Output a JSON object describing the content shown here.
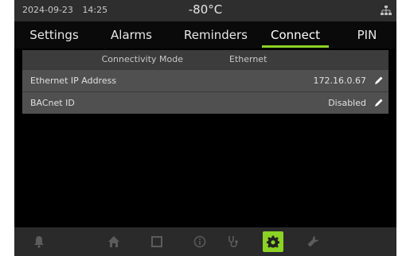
{
  "status": {
    "date": "2024-09-23",
    "time": "14:25",
    "temperature": "-80°C"
  },
  "tabs": [
    {
      "label": "Settings"
    },
    {
      "label": "Alarms"
    },
    {
      "label": "Reminders"
    },
    {
      "label": "Connect",
      "active": true
    },
    {
      "label": "PIN"
    }
  ],
  "connect": {
    "mode_label": "Connectivity Mode",
    "mode_value": "Ethernet",
    "rows": [
      {
        "label": "Ethernet IP Address",
        "value": "172.16.0.67"
      },
      {
        "label": "BACnet ID",
        "value": "Disabled"
      }
    ]
  },
  "bottom_nav": [
    {
      "icon": "bell-icon"
    },
    {
      "icon": "home-icon"
    },
    {
      "icon": "square-icon"
    },
    {
      "icon": "info-icon"
    },
    {
      "icon": "stethoscope-icon"
    },
    {
      "icon": "gear-icon",
      "active": true
    },
    {
      "icon": "wrench-icon"
    }
  ],
  "colors": {
    "accent": "#8bd225",
    "background": "#000000",
    "panel": "#4a4a4a",
    "icon_inactive": "#5c5c5c"
  }
}
